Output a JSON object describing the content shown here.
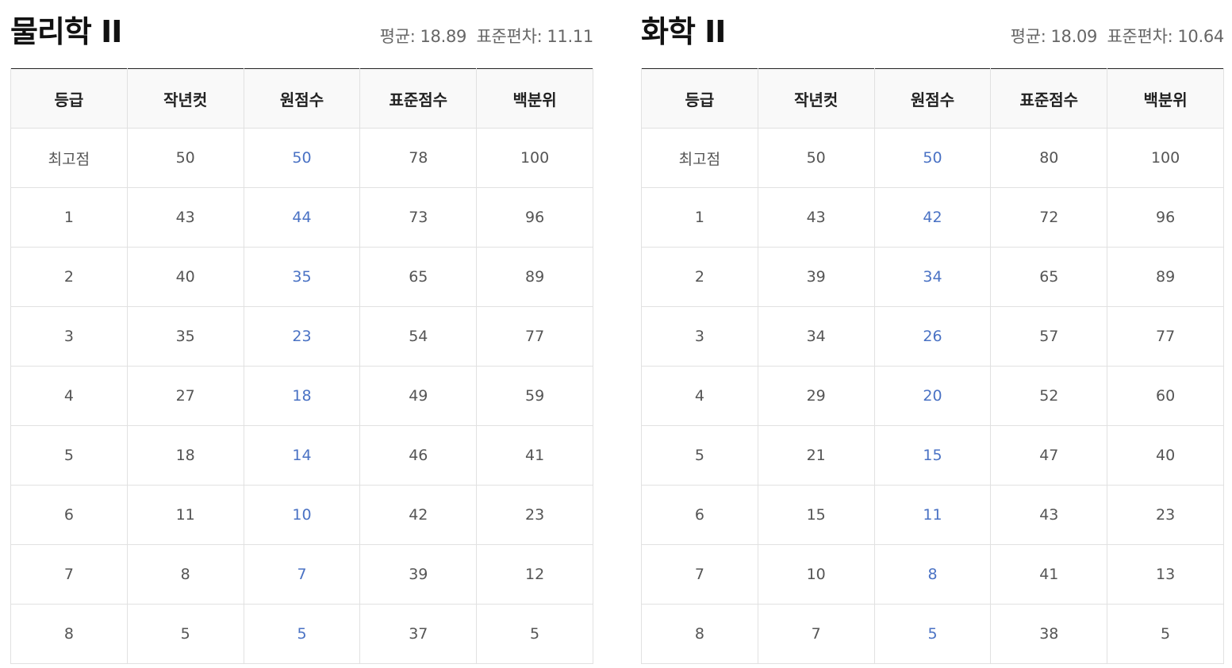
{
  "columns": [
    "등급",
    "작년컷",
    "원점수",
    "표준점수",
    "백분위"
  ],
  "accent_color": "#4a72c4",
  "panels": [
    {
      "title": "물리학 II",
      "stats": {
        "mean_label": "평균:",
        "mean": "18.89",
        "sd_label": "표준편차:",
        "sd": "11.11"
      },
      "rows": [
        [
          "최고점",
          "50",
          "50",
          "78",
          "100"
        ],
        [
          "1",
          "43",
          "44",
          "73",
          "96"
        ],
        [
          "2",
          "40",
          "35",
          "65",
          "89"
        ],
        [
          "3",
          "35",
          "23",
          "54",
          "77"
        ],
        [
          "4",
          "27",
          "18",
          "49",
          "59"
        ],
        [
          "5",
          "18",
          "14",
          "46",
          "41"
        ],
        [
          "6",
          "11",
          "10",
          "42",
          "23"
        ],
        [
          "7",
          "8",
          "7",
          "39",
          "12"
        ],
        [
          "8",
          "5",
          "5",
          "37",
          "5"
        ]
      ]
    },
    {
      "title": "화학 II",
      "stats": {
        "mean_label": "평균:",
        "mean": "18.09",
        "sd_label": "표준편차:",
        "sd": "10.64"
      },
      "rows": [
        [
          "최고점",
          "50",
          "50",
          "80",
          "100"
        ],
        [
          "1",
          "43",
          "42",
          "72",
          "96"
        ],
        [
          "2",
          "39",
          "34",
          "65",
          "89"
        ],
        [
          "3",
          "34",
          "26",
          "57",
          "77"
        ],
        [
          "4",
          "29",
          "20",
          "52",
          "60"
        ],
        [
          "5",
          "21",
          "15",
          "47",
          "40"
        ],
        [
          "6",
          "15",
          "11",
          "43",
          "23"
        ],
        [
          "7",
          "10",
          "8",
          "41",
          "13"
        ],
        [
          "8",
          "7",
          "5",
          "38",
          "5"
        ]
      ]
    }
  ]
}
